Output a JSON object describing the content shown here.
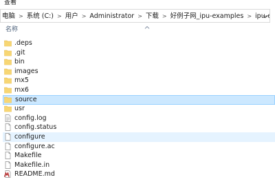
{
  "menu": {
    "view_label": "查看"
  },
  "address": {
    "crumbs": [
      "电脑",
      "系统 (C:)",
      "用户",
      "Administrator",
      "下载",
      "好例子网_ipu-examples",
      "ipu-examples"
    ]
  },
  "header": {
    "name_column": "名称"
  },
  "files": [
    {
      "name": ".deps",
      "type": "folder"
    },
    {
      "name": ".git",
      "type": "folder"
    },
    {
      "name": "bin",
      "type": "folder"
    },
    {
      "name": "images",
      "type": "folder"
    },
    {
      "name": "mx5",
      "type": "folder"
    },
    {
      "name": "mx6",
      "type": "folder"
    },
    {
      "name": "source",
      "type": "folder",
      "state": "selected"
    },
    {
      "name": "usr",
      "type": "folder"
    },
    {
      "name": "config.log",
      "type": "text-file"
    },
    {
      "name": "config.status",
      "type": "file"
    },
    {
      "name": "configure",
      "type": "file",
      "state": "hover"
    },
    {
      "name": "configure.ac",
      "type": "file"
    },
    {
      "name": "Makefile",
      "type": "file"
    },
    {
      "name": "Makefile.in",
      "type": "file"
    },
    {
      "name": "README.md",
      "type": "markdown-file"
    }
  ],
  "colors": {
    "folder": "#f7d674",
    "folder_dark": "#e2b545",
    "selected_bg": "#cce8ff",
    "selected_border": "#99d1ff",
    "hover_bg": "#e5f3ff",
    "header_text": "#4c607a",
    "markdown_icon": "#b01d1d"
  }
}
